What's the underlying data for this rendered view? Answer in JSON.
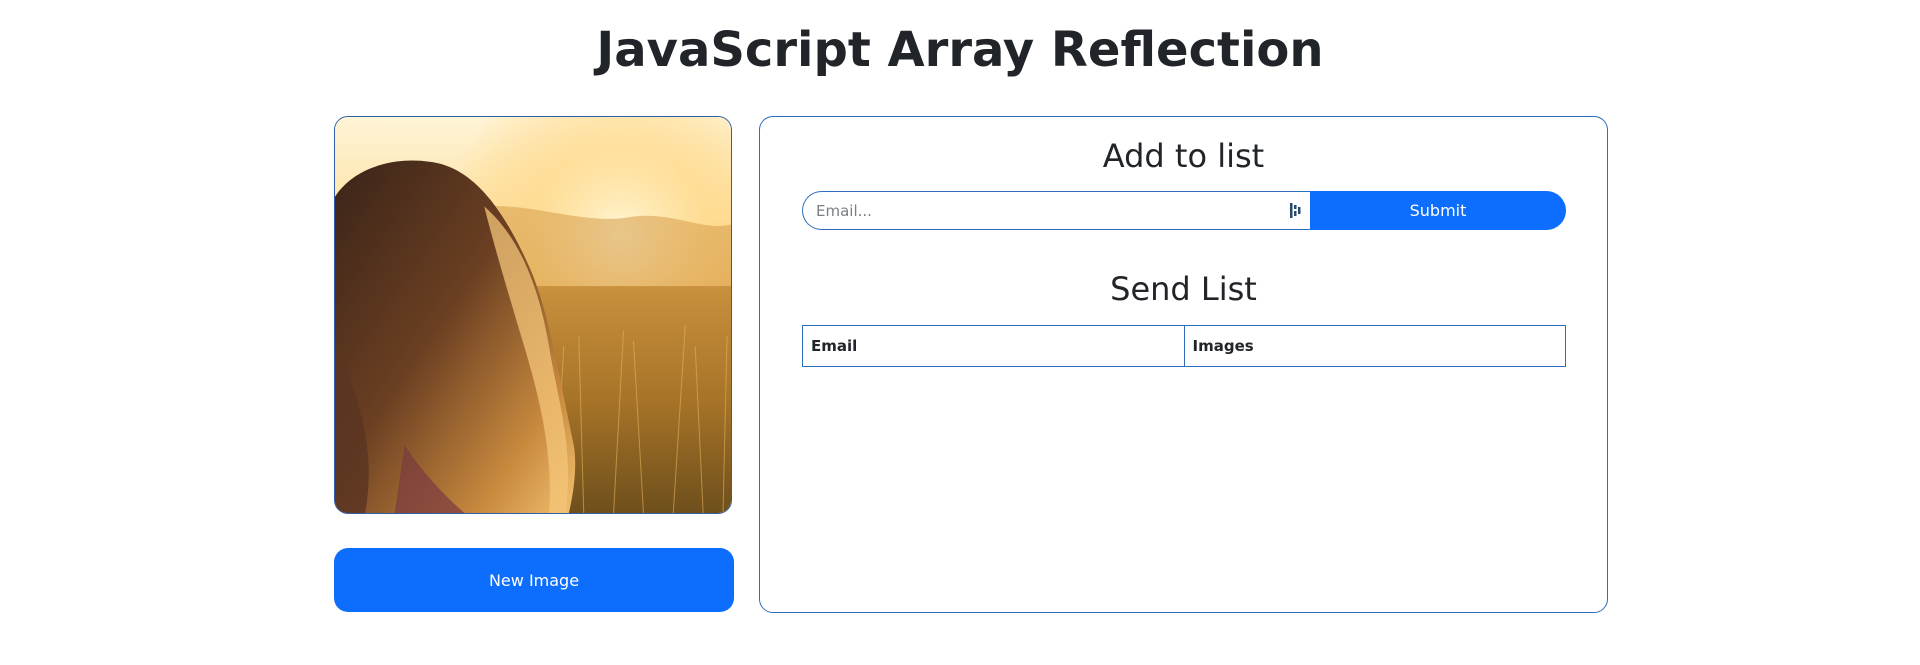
{
  "page": {
    "title": "JavaScript Array Reflection"
  },
  "image_panel": {
    "image_alt": "Woman with long hair in a sunlit field",
    "new_image_label": "New Image"
  },
  "add_section": {
    "heading": "Add to list",
    "email_placeholder": "Email...",
    "email_value": "",
    "submit_label": "Submit"
  },
  "send_section": {
    "heading": "Send List",
    "table": {
      "columns": [
        "Email",
        "Images"
      ],
      "rows": []
    }
  },
  "colors": {
    "accent": "#0d6efd",
    "border": "#2f6dbd",
    "text": "#212529"
  },
  "icons": {
    "autofill": "password-manager-icon"
  }
}
